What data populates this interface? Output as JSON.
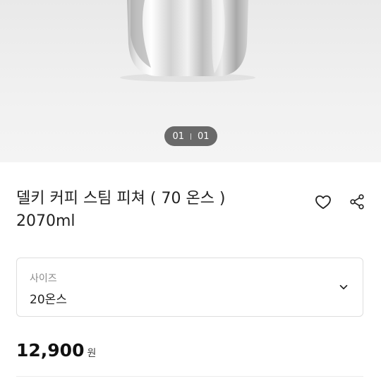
{
  "gallery": {
    "current_page": "01",
    "total_pages": "01"
  },
  "product": {
    "title_line1": "델키 커피 스팀 피쳐 ( 70 온스 )",
    "title_line2": "2070ml",
    "price_amount": "12,900",
    "price_unit": "원"
  },
  "option": {
    "label": "사이즈",
    "selected_value": "20온스"
  },
  "icons": {
    "wishlist": "heart-icon",
    "share": "share-icon",
    "dropdown": "chevron-down-icon"
  }
}
